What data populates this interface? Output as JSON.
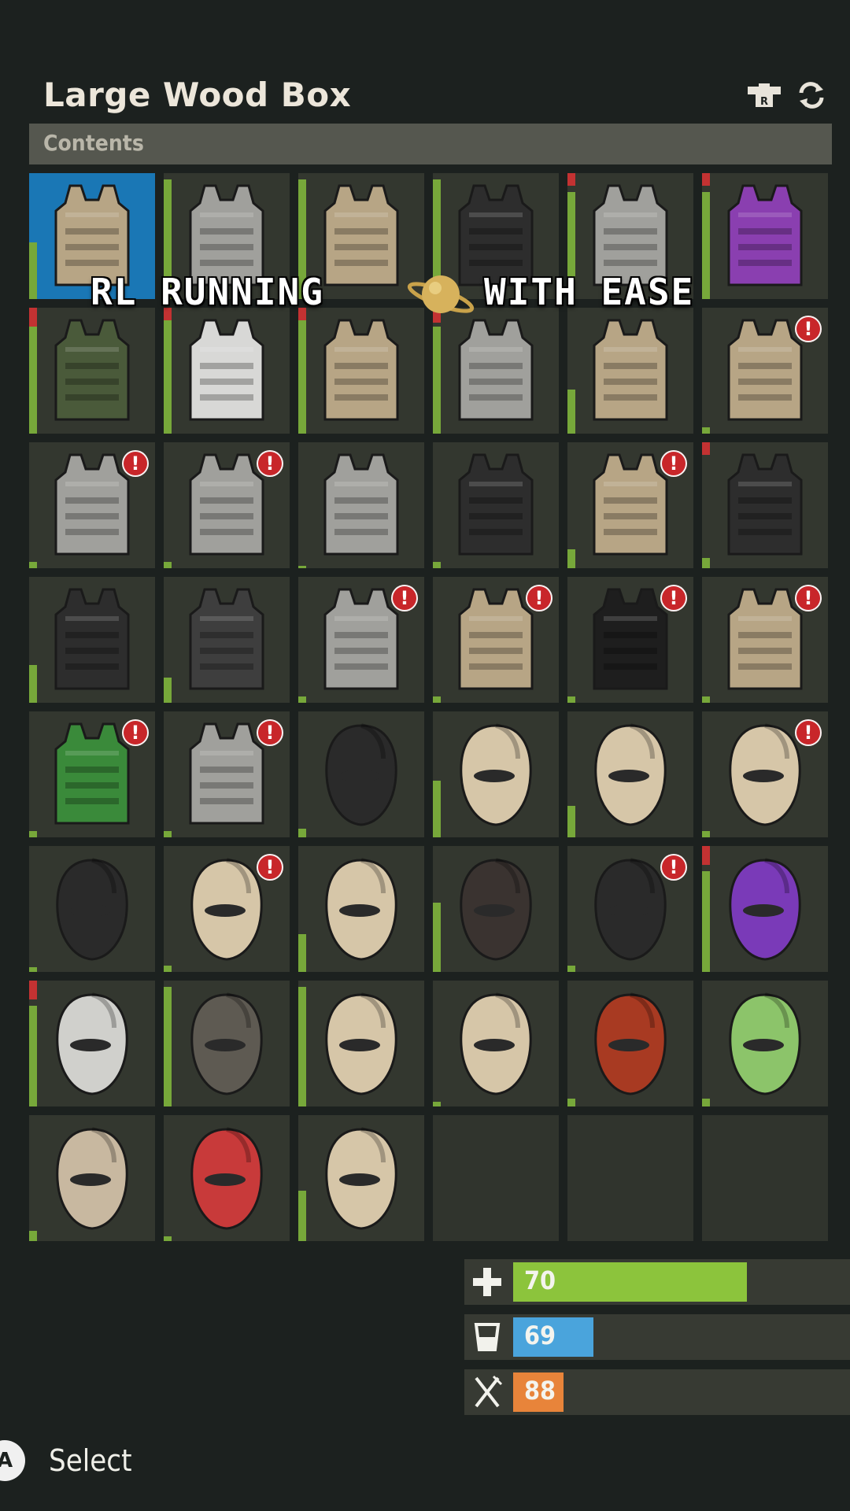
{
  "header": {
    "title": "Large Wood Box",
    "section_label": "Contents"
  },
  "overlay_text": {
    "left": "RL RUNNING",
    "right": "WITH EASE"
  },
  "footer": {
    "button_glyph": "A",
    "action_label": "Select"
  },
  "stats": [
    {
      "name": "health",
      "icon": "plus-icon",
      "value": "70",
      "fraction": 0.7,
      "color": "#8cc43c"
    },
    {
      "name": "water",
      "icon": "cup-icon",
      "value": "69",
      "fraction": 0.24,
      "color": "#4aa4dc"
    },
    {
      "name": "food",
      "icon": "fork-knife-icon",
      "value": "88",
      "fraction": 0.15,
      "color": "#e8843a"
    }
  ],
  "slots": [
    {
      "kind": "vest",
      "color": "#b7a585",
      "cond": 0.45,
      "red": 0,
      "alert": false,
      "selected": true
    },
    {
      "kind": "vest",
      "color": "#a0a09c",
      "cond": 0.95,
      "red": 0,
      "alert": false
    },
    {
      "kind": "vest",
      "color": "#b7a585",
      "cond": 0.95,
      "red": 0,
      "alert": false
    },
    {
      "kind": "vest",
      "color": "#2d2d2d",
      "cond": 0.95,
      "red": 0,
      "alert": false
    },
    {
      "kind": "vest",
      "color": "#a0a09c",
      "cond": 0.85,
      "red": 0.1,
      "alert": false
    },
    {
      "kind": "vest",
      "color": "#8a3fb0",
      "cond": 0.85,
      "red": 0.1,
      "alert": false
    },
    {
      "kind": "vest",
      "color": "#4a5a3a",
      "cond": 0.85,
      "red": 0.15,
      "alert": false
    },
    {
      "kind": "vest",
      "color": "#d8d8d6",
      "cond": 0.95,
      "red": 0.1,
      "alert": false
    },
    {
      "kind": "vest",
      "color": "#b7a585",
      "cond": 0.95,
      "red": 0.1,
      "alert": false
    },
    {
      "kind": "vest",
      "color": "#a0a09c",
      "cond": 0.85,
      "red": 0.12,
      "alert": false
    },
    {
      "kind": "vest",
      "color": "#b7a585",
      "cond": 0.35,
      "red": 0,
      "alert": false
    },
    {
      "kind": "vest",
      "color": "#b7a585",
      "cond": 0.05,
      "red": 0,
      "alert": true
    },
    {
      "kind": "vest",
      "color": "#a0a09c",
      "cond": 0.05,
      "red": 0,
      "alert": true
    },
    {
      "kind": "vest",
      "color": "#a0a09c",
      "cond": 0.05,
      "red": 0,
      "alert": true
    },
    {
      "kind": "vest",
      "color": "#a0a09c",
      "cond": 0.02,
      "red": 0,
      "alert": false
    },
    {
      "kind": "vest",
      "color": "#2d2d2d",
      "cond": 0.05,
      "red": 0,
      "alert": false
    },
    {
      "kind": "vest",
      "color": "#b7a585",
      "cond": 0.15,
      "red": 0,
      "alert": true
    },
    {
      "kind": "vest",
      "color": "#2d2d2d",
      "cond": 0.08,
      "red": 0.1,
      "alert": false
    },
    {
      "kind": "vest",
      "color": "#2d2d2d",
      "cond": 0.3,
      "red": 0,
      "alert": false
    },
    {
      "kind": "vest",
      "color": "#3e3e3e",
      "cond": 0.2,
      "red": 0,
      "alert": false
    },
    {
      "kind": "vest",
      "color": "#a0a09c",
      "cond": 0.05,
      "red": 0,
      "alert": true
    },
    {
      "kind": "vest",
      "color": "#b7a585",
      "cond": 0.05,
      "red": 0,
      "alert": true
    },
    {
      "kind": "vest",
      "color": "#1e1e1e",
      "cond": 0.05,
      "red": 0,
      "alert": true
    },
    {
      "kind": "vest",
      "color": "#b7a585",
      "cond": 0.05,
      "red": 0,
      "alert": true
    },
    {
      "kind": "vest",
      "color": "#3a8a3a",
      "cond": 0.05,
      "red": 0,
      "alert": true
    },
    {
      "kind": "vest",
      "color": "#a0a09c",
      "cond": 0.05,
      "red": 0,
      "alert": true
    },
    {
      "kind": "mask",
      "color": "#2a2a2a",
      "cond": 0.07,
      "red": 0,
      "alert": false
    },
    {
      "kind": "mask",
      "color": "#d6c6a8",
      "cond": 0.45,
      "red": 0,
      "alert": false
    },
    {
      "kind": "mask",
      "color": "#d6c6a8",
      "cond": 0.25,
      "red": 0,
      "alert": false
    },
    {
      "kind": "mask",
      "color": "#d6c6a8",
      "cond": 0.05,
      "red": 0,
      "alert": true
    },
    {
      "kind": "mask",
      "color": "#2a2a2a",
      "cond": 0.04,
      "red": 0,
      "alert": false
    },
    {
      "kind": "mask",
      "color": "#d6c6a8",
      "cond": 0.05,
      "red": 0,
      "alert": true
    },
    {
      "kind": "mask",
      "color": "#d6c6a8",
      "cond": 0.3,
      "red": 0,
      "alert": false
    },
    {
      "kind": "mask",
      "color": "#3a3330",
      "cond": 0.55,
      "red": 0,
      "alert": false
    },
    {
      "kind": "mask",
      "color": "#2a2a2a",
      "cond": 0.05,
      "red": 0,
      "alert": true
    },
    {
      "kind": "mask",
      "color": "#7a3ab8",
      "cond": 0.8,
      "red": 0.15,
      "alert": false
    },
    {
      "kind": "mask",
      "color": "#d0d0cc",
      "cond": 0.8,
      "red": 0.15,
      "alert": false
    },
    {
      "kind": "mask",
      "color": "#5e5a52",
      "cond": 0.95,
      "red": 0,
      "alert": false
    },
    {
      "kind": "mask",
      "color": "#d6c6a8",
      "cond": 0.95,
      "red": 0,
      "alert": false
    },
    {
      "kind": "mask",
      "color": "#d6c6a8",
      "cond": 0.04,
      "red": 0,
      "alert": false
    },
    {
      "kind": "mask",
      "color": "#a83a22",
      "cond": 0.06,
      "red": 0,
      "alert": false
    },
    {
      "kind": "mask",
      "color": "#8cc46a",
      "cond": 0.06,
      "red": 0,
      "alert": false
    },
    {
      "kind": "mask",
      "color": "#c8b8a0",
      "cond": 0.08,
      "red": 0,
      "alert": false
    },
    {
      "kind": "mask",
      "color": "#c83a3a",
      "cond": 0.04,
      "red": 0,
      "alert": false
    },
    {
      "kind": "mask",
      "color": "#d6c6a8",
      "cond": 0.4,
      "red": 0,
      "alert": false
    },
    {
      "kind": "empty"
    },
    {
      "kind": "empty"
    },
    {
      "kind": "empty"
    }
  ]
}
